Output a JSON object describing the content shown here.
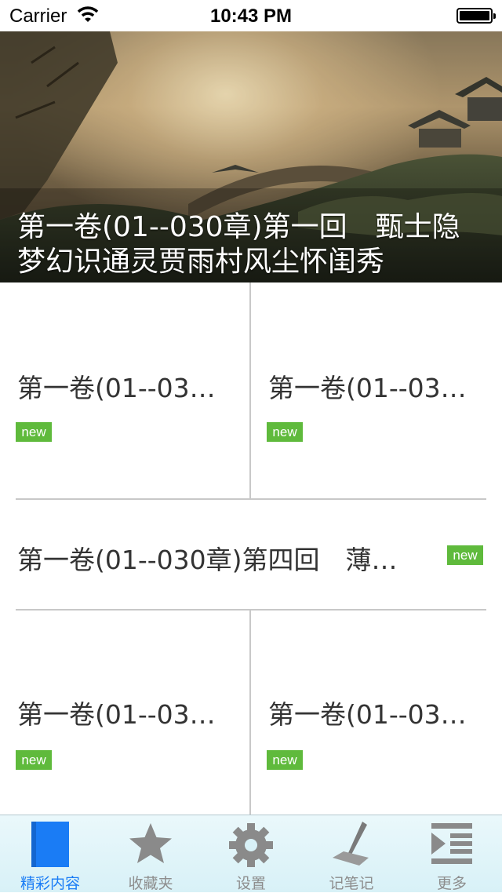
{
  "status_bar": {
    "carrier": "Carrier",
    "time": "10:43 PM"
  },
  "banner": {
    "title": "第一卷(01--030章)第一回　甄士隐梦幻识通灵贾雨村风尘怀闺秀"
  },
  "grid": {
    "row1_left": {
      "title": "第一卷(01--03…",
      "badge": "new"
    },
    "row1_right": {
      "title": "第一卷(01--03…",
      "badge": "new"
    },
    "row2": {
      "title": "第一卷(01--030章)第四回　薄…",
      "badge": "new"
    },
    "row3_left": {
      "title": "第一卷(01--03…",
      "badge": "new"
    },
    "row3_right": {
      "title": "第一卷(01--03…",
      "badge": "new"
    }
  },
  "tab_bar": {
    "tabs": [
      {
        "label": "精彩内容",
        "icon": "book-icon",
        "active": true
      },
      {
        "label": "收藏夹",
        "icon": "star-icon",
        "active": false
      },
      {
        "label": "设置",
        "icon": "gear-icon",
        "active": false
      },
      {
        "label": "记笔记",
        "icon": "pen-icon",
        "active": false
      },
      {
        "label": "更多",
        "icon": "list-icon",
        "active": false
      }
    ],
    "active_color": "#1a7cf5",
    "inactive_color": "#8d8d8d"
  },
  "colors": {
    "badge": "#5fba3c"
  }
}
